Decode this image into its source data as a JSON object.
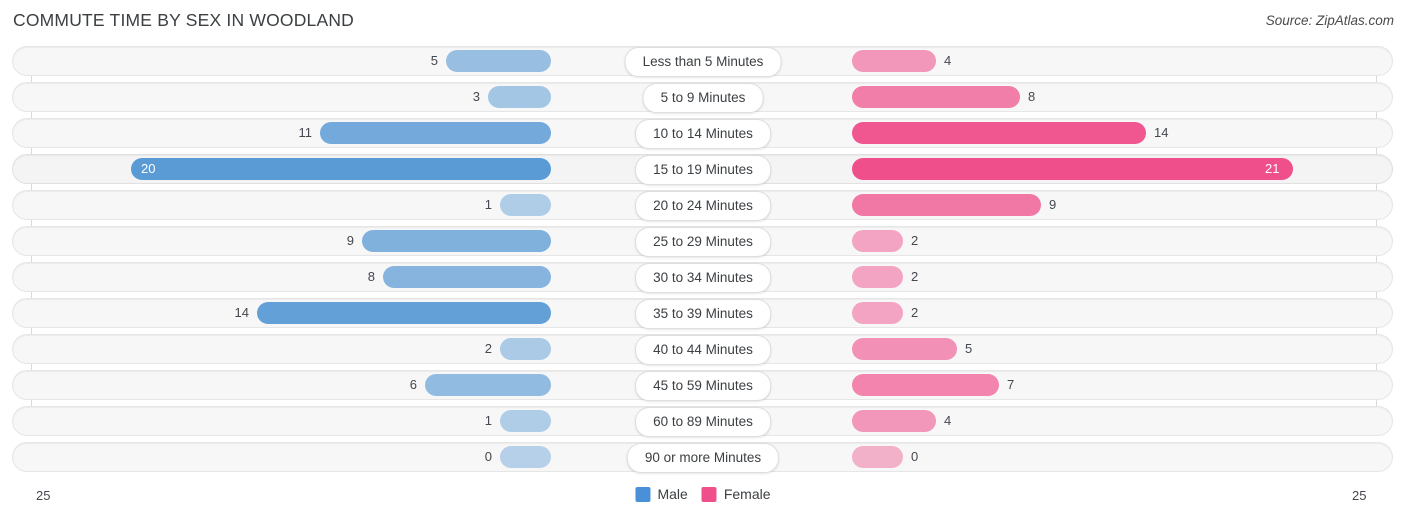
{
  "header": {
    "title": "COMMUTE TIME BY SEX IN WOODLAND",
    "source": "Source: ZipAtlas.com"
  },
  "axis": {
    "left_max_label": "25",
    "right_max_label": "25",
    "max": 25
  },
  "legend": {
    "items": [
      {
        "label": "Male",
        "color": "#4a90d9"
      },
      {
        "label": "Female",
        "color": "#ef4f8b"
      }
    ]
  },
  "colors": {
    "male": "#5b9bd5",
    "female": "#ef4f8b",
    "track": "#f7f7f7",
    "grid": "#d9d9d9",
    "text": "#44484f"
  },
  "chart_data": {
    "type": "bar",
    "subtype": "diverging-bidirectional-bar",
    "title": "COMMUTE TIME BY SEX IN WOODLAND",
    "xlabel": "",
    "ylabel": "",
    "xlim": [
      25,
      25
    ],
    "grid": true,
    "legend_position": "bottom-center",
    "categories": [
      "Less than 5 Minutes",
      "5 to 9 Minutes",
      "10 to 14 Minutes",
      "15 to 19 Minutes",
      "20 to 24 Minutes",
      "25 to 29 Minutes",
      "30 to 34 Minutes",
      "35 to 39 Minutes",
      "40 to 44 Minutes",
      "45 to 59 Minutes",
      "60 to 89 Minutes",
      "90 or more Minutes"
    ],
    "series": [
      {
        "name": "Male",
        "direction": "left",
        "values": [
          5,
          3,
          11,
          20,
          1,
          9,
          8,
          14,
          2,
          6,
          1,
          0
        ]
      },
      {
        "name": "Female",
        "direction": "right",
        "values": [
          4,
          8,
          14,
          21,
          9,
          2,
          2,
          2,
          5,
          7,
          4,
          0
        ]
      }
    ]
  },
  "rows": [
    {
      "label": "Less than 5 Minutes",
      "male": 5,
      "male_text": "5",
      "female": 4,
      "female_text": "4",
      "highlight": false
    },
    {
      "label": "5 to 9 Minutes",
      "male": 3,
      "male_text": "3",
      "female": 8,
      "female_text": "8",
      "highlight": false
    },
    {
      "label": "10 to 14 Minutes",
      "male": 11,
      "male_text": "11",
      "female": 14,
      "female_text": "14",
      "highlight": false
    },
    {
      "label": "15 to 19 Minutes",
      "male": 20,
      "male_text": "20",
      "female": 21,
      "female_text": "21",
      "highlight": true
    },
    {
      "label": "20 to 24 Minutes",
      "male": 1,
      "male_text": "1",
      "female": 9,
      "female_text": "9",
      "highlight": false
    },
    {
      "label": "25 to 29 Minutes",
      "male": 9,
      "male_text": "9",
      "female": 2,
      "female_text": "2",
      "highlight": false
    },
    {
      "label": "30 to 34 Minutes",
      "male": 8,
      "male_text": "8",
      "female": 2,
      "female_text": "2",
      "highlight": false
    },
    {
      "label": "35 to 39 Minutes",
      "male": 14,
      "male_text": "14",
      "female": 2,
      "female_text": "2",
      "highlight": false
    },
    {
      "label": "40 to 44 Minutes",
      "male": 2,
      "male_text": "2",
      "female": 5,
      "female_text": "5",
      "highlight": false
    },
    {
      "label": "45 to 59 Minutes",
      "male": 6,
      "male_text": "6",
      "female": 7,
      "female_text": "7",
      "highlight": false
    },
    {
      "label": "60 to 89 Minutes",
      "male": 1,
      "male_text": "1",
      "female": 4,
      "female_text": "4",
      "highlight": false
    },
    {
      "label": "90 or more Minutes",
      "male": 0,
      "male_text": "0",
      "female": 0,
      "female_text": "0",
      "highlight": false
    }
  ]
}
